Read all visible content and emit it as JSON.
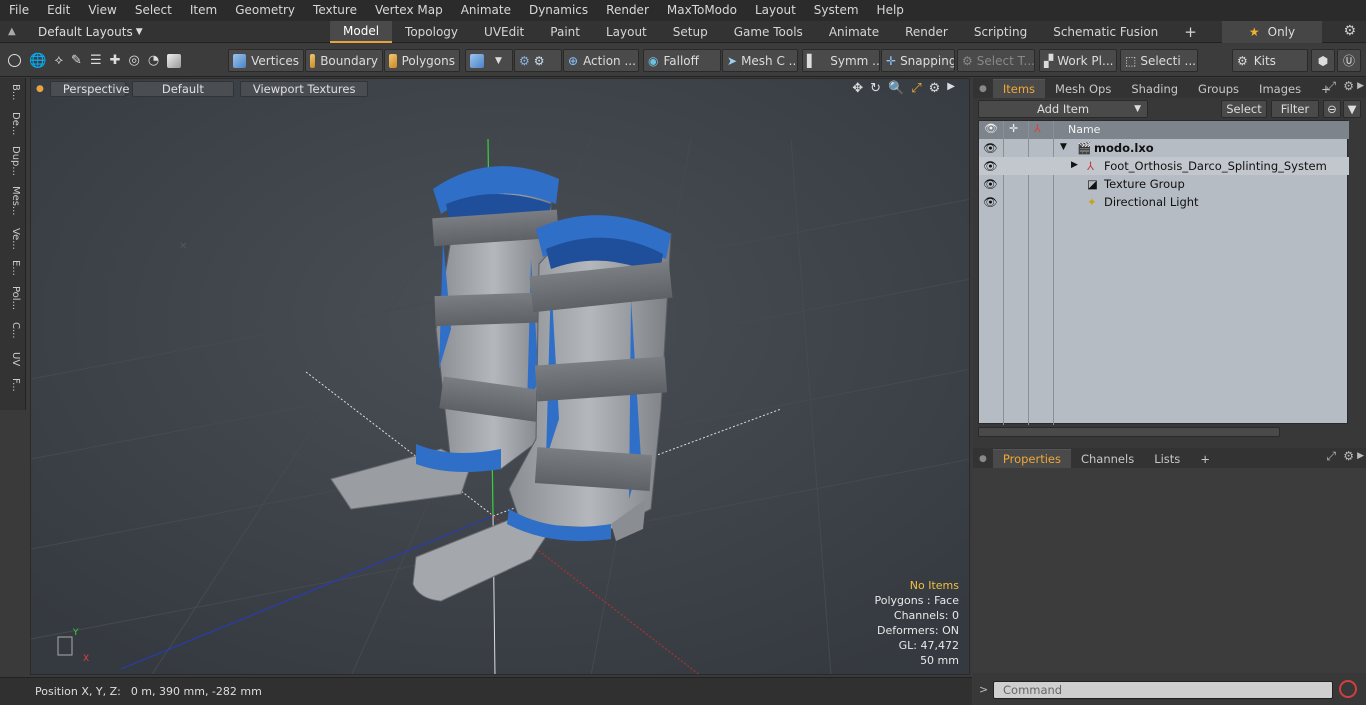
{
  "menu": [
    "File",
    "Edit",
    "View",
    "Select",
    "Item",
    "Geometry",
    "Texture",
    "Vertex Map",
    "Animate",
    "Dynamics",
    "Render",
    "MaxToModo",
    "Layout",
    "System",
    "Help"
  ],
  "layouts": {
    "label": "Default Layouts",
    "tabs": [
      "Model",
      "Topology",
      "UVEdit",
      "Paint",
      "Layout",
      "Setup",
      "Game Tools",
      "Animate",
      "Render",
      "Scripting",
      "Schematic Fusion"
    ],
    "active_tab": "Model",
    "add": "+",
    "only_label": "Only"
  },
  "toolbar": {
    "vertices": "Vertices",
    "boundary": "Boundary",
    "polygons": "Polygons",
    "action": "Action ...",
    "falloff": "Falloff",
    "mesh": "Mesh C ...",
    "symm": "Symm ...",
    "snapping": "Snapping",
    "select_t": "Select T...",
    "work_pl": "Work Pl...",
    "selecti": "Selecti ...",
    "kits": "Kits"
  },
  "left_tabs": [
    "B...",
    "De...",
    "Dup...",
    "Mes...",
    "Ve...",
    "E...",
    "Pol...",
    "C...",
    "UV",
    "F..."
  ],
  "viewport": {
    "view": "Perspective",
    "shading": "Default",
    "textures": "Viewport Textures",
    "hud": {
      "selection": "No Items",
      "polygons": "Polygons : Face",
      "channels": "Channels: 0",
      "deformers": "Deformers: ON",
      "gl": "GL: 47,472",
      "scale": "50 mm"
    }
  },
  "status": {
    "label": "Position X, Y, Z:",
    "value": "0 m, 390 mm, -282 mm"
  },
  "items_panel": {
    "tabs": [
      "Items",
      "Mesh Ops",
      "Shading",
      "Groups",
      "Images"
    ],
    "active_tab": "Items",
    "add_tab": "+",
    "add_item": "Add Item",
    "select": "Select",
    "filter": "Filter",
    "name_header": "Name",
    "rows": [
      {
        "label": "modo.lxo",
        "bold": true
      },
      {
        "label": "Foot_Orthosis_Darco_Splinting_System"
      },
      {
        "label": "Texture Group"
      },
      {
        "label": "Directional Light"
      }
    ]
  },
  "properties_panel": {
    "tabs": [
      "Properties",
      "Channels",
      "Lists"
    ],
    "active_tab": "Properties",
    "add_tab": "+"
  },
  "command": {
    "placeholder": "Command"
  }
}
